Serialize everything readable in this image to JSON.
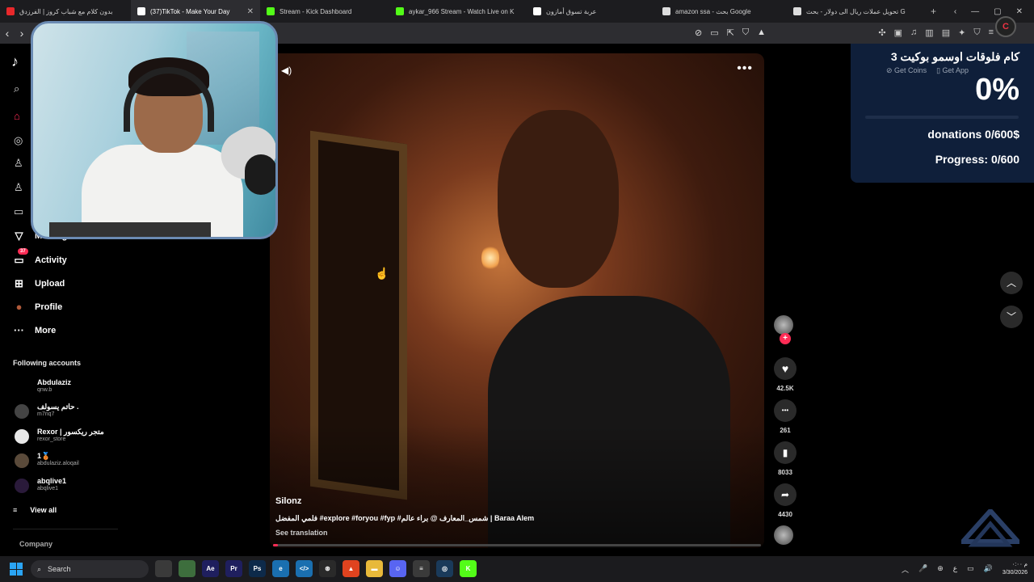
{
  "browser": {
    "tabs": [
      {
        "title": "بدون كلام مع شباب كروز | الفرزدق",
        "color": "#e8282b",
        "active": false
      },
      {
        "title": "(37)TikTok - Make Your Day",
        "color": "#ffffff",
        "active": true
      },
      {
        "title": "Stream - Kick Dashboard",
        "color": "#53fc18",
        "active": false
      },
      {
        "title": "aykar_966 Stream - Watch Live on K",
        "color": "#53fc18",
        "active": false
      },
      {
        "title": "عربة تسوق أمازون",
        "color": "#ffffff",
        "active": false
      },
      {
        "title": "amazon ssa - بحث Google",
        "color": "#dddddd",
        "active": false
      },
      {
        "title": "تحويل عملات ريال الى دولار - بحث G",
        "color": "#dddddd",
        "active": false
      }
    ],
    "close_glyph": "✕",
    "new_tab_glyph": "+",
    "window_controls": [
      "‹",
      "—",
      "▢",
      "✕"
    ],
    "profile_letter": "C"
  },
  "sidebar": {
    "logo_glyph": "♪",
    "nav": [
      {
        "label": "Messages",
        "icon": "paper-plane-icon",
        "glyph": "▽"
      },
      {
        "label": "Activity",
        "icon": "inbox-icon",
        "glyph": "▭",
        "badge": "37"
      },
      {
        "label": "Upload",
        "icon": "plus-square-icon",
        "glyph": "⊞"
      },
      {
        "label": "Profile",
        "icon": "profile-avatar-icon",
        "glyph": "●"
      },
      {
        "label": "More",
        "icon": "more-dots-icon",
        "glyph": "···"
      }
    ],
    "following_title": "Following accounts",
    "accounts": [
      {
        "name": "Abdulaziz",
        "handle": "qnw.b",
        "color": "#000000"
      },
      {
        "name": "حاتم يسولف .",
        "handle": "m7nq7",
        "color": "#444444"
      },
      {
        "name": "Rexor | متجر ريكسور",
        "handle": "rexor_store",
        "color": "#e8e8e8"
      },
      {
        "name": "1🥉",
        "handle": "abdulaziz.aloqail",
        "color": "#5a4a3a"
      },
      {
        "name": "abqlive1",
        "handle": "abqlive1",
        "color": "#2a1a3a"
      }
    ],
    "view_all": "View all",
    "view_all_glyph": "≡",
    "company": "Company"
  },
  "video": {
    "author": "Silonz",
    "caption": "فلمي المفضل #explore #foryou #fyp #شمس_المعارف @ براء عالم | Baraa Alem",
    "see_translation": "See translation",
    "progress": 0.01,
    "volume_glyph": "◀)",
    "more_glyph": "•••"
  },
  "actions": {
    "likes": "42.5K",
    "comments": "261",
    "saves": "8033",
    "shares": "4430",
    "follow_glyph": "+",
    "like_glyph": "♥",
    "comment_glyph": "•••",
    "save_glyph": "▮",
    "share_glyph": "➦"
  },
  "scroll": {
    "up_glyph": "︿",
    "down_glyph": "﹀"
  },
  "overlay": {
    "title": "كام فلوقات اوسمو بوكيت 3",
    "get_coins": "Get Coins",
    "get_app": "Get App",
    "percent": "0%",
    "donations": "donations 0/600$",
    "progress_text": "Progress: 0/600",
    "progress_value": 0
  },
  "taskbar": {
    "search_label": "Search",
    "search_glyph": "⌕",
    "apps": [
      {
        "name": "file-icon",
        "label": "",
        "color": "#3a3a3a"
      },
      {
        "name": "chrome-icon",
        "label": "",
        "color": "#3d6e3d"
      },
      {
        "name": "after-effects-icon",
        "label": "Ae",
        "color": "#1f1f5e"
      },
      {
        "name": "premiere-icon",
        "label": "Pr",
        "color": "#1f1f5e"
      },
      {
        "name": "photoshop-icon",
        "label": "Ps",
        "color": "#0d2a4a"
      },
      {
        "name": "edge-icon",
        "label": "e",
        "color": "#1a6fb0"
      },
      {
        "name": "vscode-icon",
        "label": "</>",
        "color": "#1a6fb0"
      },
      {
        "name": "chatgpt-icon",
        "label": "⊛",
        "color": "#2a2a2a"
      },
      {
        "name": "brave-icon",
        "label": "▲",
        "color": "#e0431f"
      },
      {
        "name": "file-explorer-icon",
        "label": "▬",
        "color": "#e8b93a"
      },
      {
        "name": "discord-icon",
        "label": "☺",
        "color": "#5865f2"
      },
      {
        "name": "notepad-icon",
        "label": "≡",
        "color": "#3a3a3a"
      },
      {
        "name": "steam-icon",
        "label": "◎",
        "color": "#1a3a5a"
      },
      {
        "name": "kick-app-icon",
        "label": "K",
        "color": "#53fc18"
      }
    ],
    "tray_glyphs": [
      "︿",
      "🎤",
      "⊕",
      "ع",
      "▭",
      "🔊"
    ],
    "time": "م ٠:٠٠",
    "date": "3/30/2026"
  }
}
